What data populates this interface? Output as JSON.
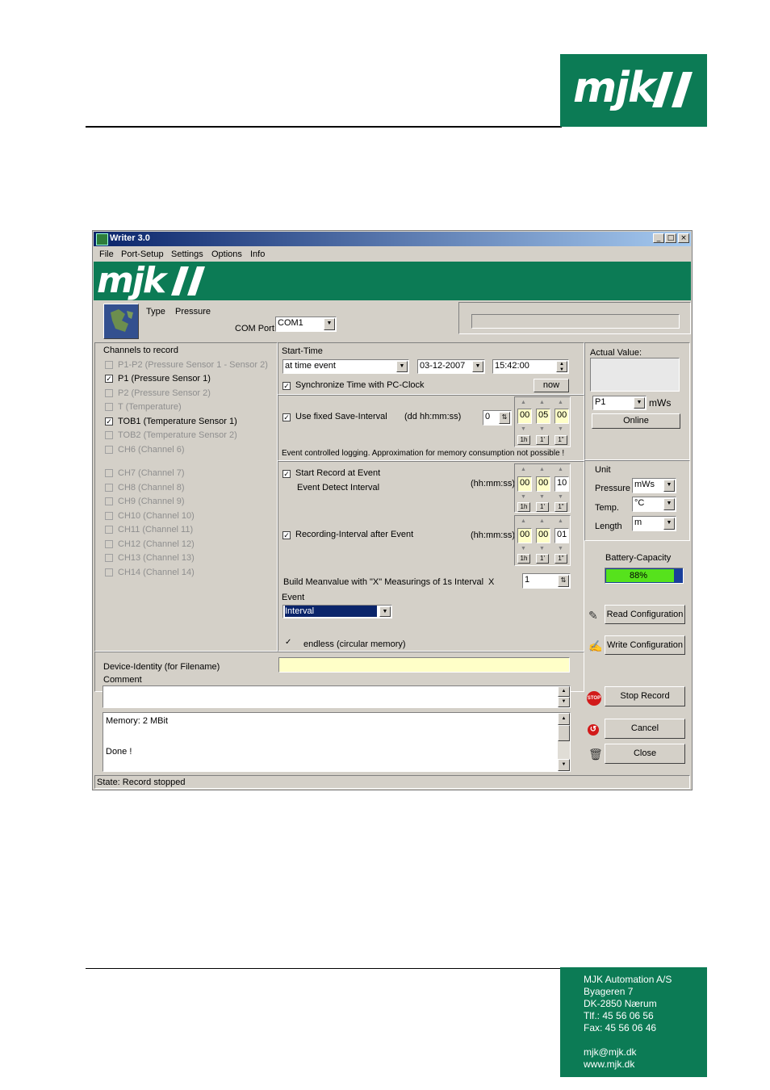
{
  "doc": {
    "brand_logo": "mjk",
    "footer": {
      "company": "MJK Automation A/S",
      "street": "Byageren 7",
      "city": "DK-2850 Nærum",
      "phone": "Tlf.:  45 56 06 56",
      "fax": "Fax:  45 56 06 46",
      "email": "mjk@mjk.dk",
      "web": "www.mjk.dk"
    }
  },
  "window": {
    "title": "Writer  3.0",
    "menu": [
      "File",
      "Port-Setup",
      "Settings",
      "Options",
      "Info"
    ],
    "banner_logo": "mjk",
    "type_label": "Type",
    "type_value": "Pressure",
    "com_port_label": "COM Port",
    "com_port_value": "COM1"
  },
  "channels": {
    "title": "Channels to record",
    "group1": [
      {
        "label": "P1-P2 (Pressure Sensor 1 - Sensor 2)",
        "checked": false,
        "enabled": false
      },
      {
        "label": "P1 (Pressure Sensor 1)",
        "checked": true,
        "enabled": true
      },
      {
        "label": "P2 (Pressure Sensor 2)",
        "checked": false,
        "enabled": false
      },
      {
        "label": "T (Temperature)",
        "checked": false,
        "enabled": false
      },
      {
        "label": "TOB1 (Temperature Sensor 1)",
        "checked": true,
        "enabled": true
      },
      {
        "label": "TOB2 (Temperature Sensor 2)",
        "checked": false,
        "enabled": false
      },
      {
        "label": "CH6 (Channel 6)",
        "checked": false,
        "enabled": false
      }
    ],
    "group2": [
      {
        "label": "CH7 (Channel 7)",
        "checked": false,
        "enabled": false
      },
      {
        "label": "CH8 (Channel 8)",
        "checked": false,
        "enabled": false
      },
      {
        "label": "CH9 (Channel 9)",
        "checked": false,
        "enabled": false
      },
      {
        "label": "CH10 (Channel 10)",
        "checked": false,
        "enabled": false
      },
      {
        "label": "CH11 (Channel 11)",
        "checked": false,
        "enabled": false
      },
      {
        "label": "CH12 (Channel 12)",
        "checked": false,
        "enabled": false
      },
      {
        "label": "CH13 (Channel 13)",
        "checked": false,
        "enabled": false
      },
      {
        "label": "CH14 (Channel 14)",
        "checked": false,
        "enabled": false
      }
    ]
  },
  "start": {
    "label": "Start-Time",
    "mode": "at time event",
    "date": "03-12-2007",
    "time": "15:42:00",
    "sync_label": "Synchronize Time with PC-Clock",
    "now_button": "now"
  },
  "save_interval": {
    "label": "Use fixed Save-Interval",
    "format": "(dd hh:mm:ss)",
    "days": "0",
    "hh": "00",
    "mm": "05",
    "ss": "00",
    "note": "Event controlled logging. Approximation for memory consumption not possible !"
  },
  "event_record": {
    "label": "Start Record at Event",
    "sub_label": "Event Detect Interval",
    "format": "(hh:mm:ss)",
    "hh": "00",
    "mm": "00",
    "ss": "10"
  },
  "recording_interval": {
    "label": "Recording-Interval after Event",
    "format": "(hh:mm:ss)",
    "hh": "00",
    "mm": "00",
    "ss": "01"
  },
  "step_buttons": [
    "1h",
    "1'",
    "1\""
  ],
  "meanvalue": {
    "label": "Build Meanvalue with \"X\" Measurings of 1s Interval",
    "x": "X",
    "value": "1"
  },
  "event": {
    "label": "Event",
    "value": "Interval"
  },
  "endless_label": "endless (circular memory)",
  "actual": {
    "label": "Actual Value:",
    "channel": "P1",
    "unit": "mWs",
    "online_button": "Online"
  },
  "unit": {
    "title": "Unit",
    "pressure_label": "Pressure",
    "pressure_value": "mWs",
    "temp_label": "Temp.",
    "temp_value": "°C",
    "length_label": "Length",
    "length_value": "m"
  },
  "battery": {
    "label": "Battery-Capacity",
    "percent_text": "88%",
    "fraction": 0.88
  },
  "buttons": {
    "read_config": "Read Configuration",
    "write_config": "Write Configuration",
    "stop_record": "Stop Record",
    "cancel": "Cancel",
    "close": "Close"
  },
  "device": {
    "identity_label": "Device-Identity (for Filename)",
    "identity_value": "",
    "comment_label": "Comment",
    "comment_value": ""
  },
  "log": {
    "line1": "Memory: 2 MBit",
    "line2": "Done !"
  },
  "status": "State: Record stopped",
  "colors": {
    "brand_green": "#0c7b55",
    "battery_green": "#56e21c",
    "battery_blue": "#1a3f9b"
  }
}
